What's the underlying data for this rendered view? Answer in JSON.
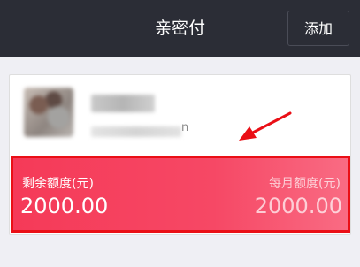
{
  "header": {
    "title": "亲密付",
    "add_label": "添加"
  },
  "card": {
    "account_tail": "n"
  },
  "quota": {
    "remaining_label": "剩余额度(元)",
    "monthly_label": "每月额度(元)",
    "remaining_value": "2000.00",
    "monthly_value": "2000.00"
  },
  "colors": {
    "header_bg": "#2b2d36",
    "quota_bg": "#f64865",
    "highlight_border": "#ea0f16",
    "arrow": "#ea0f16"
  }
}
